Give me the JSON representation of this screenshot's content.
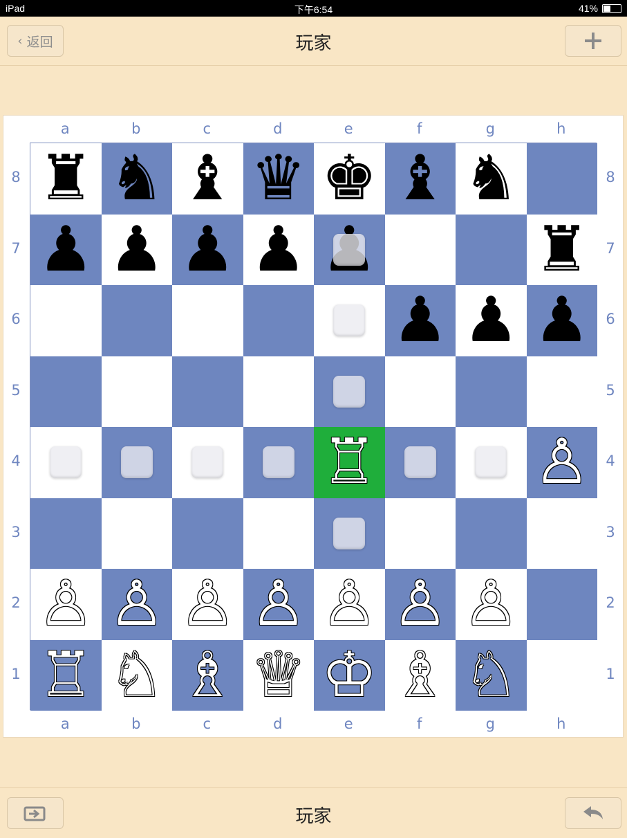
{
  "status_bar": {
    "device": "iPad",
    "time": "下午6:54",
    "battery": "41%",
    "battery_level": 0.41
  },
  "header": {
    "back_label": "返回",
    "title": "玩家",
    "add_icon": "plus-icon"
  },
  "footer": {
    "title": "玩家",
    "left_icon": "export-icon",
    "right_icon": "undo-arrow-icon"
  },
  "board": {
    "files": [
      "a",
      "b",
      "c",
      "d",
      "e",
      "f",
      "g",
      "h"
    ],
    "ranks": [
      "8",
      "7",
      "6",
      "5",
      "4",
      "3",
      "2",
      "1"
    ],
    "colors": {
      "light": "#ffffff",
      "dark": "#6e86bf",
      "selected": "#1fae3b",
      "coords": "#6f86c0"
    },
    "selected_square": "e4",
    "pieces": [
      {
        "square": "a8",
        "piece": "rook",
        "color": "black"
      },
      {
        "square": "b8",
        "piece": "knight",
        "color": "black"
      },
      {
        "square": "c8",
        "piece": "bishop",
        "color": "black"
      },
      {
        "square": "d8",
        "piece": "queen",
        "color": "black"
      },
      {
        "square": "e8",
        "piece": "king",
        "color": "black"
      },
      {
        "square": "f8",
        "piece": "bishop",
        "color": "black"
      },
      {
        "square": "g8",
        "piece": "knight",
        "color": "black"
      },
      {
        "square": "a7",
        "piece": "pawn",
        "color": "black"
      },
      {
        "square": "b7",
        "piece": "pawn",
        "color": "black"
      },
      {
        "square": "c7",
        "piece": "pawn",
        "color": "black"
      },
      {
        "square": "d7",
        "piece": "pawn",
        "color": "black"
      },
      {
        "square": "e7",
        "piece": "pawn",
        "color": "black"
      },
      {
        "square": "h7",
        "piece": "rook",
        "color": "black"
      },
      {
        "square": "f6",
        "piece": "pawn",
        "color": "black"
      },
      {
        "square": "g6",
        "piece": "pawn",
        "color": "black"
      },
      {
        "square": "h6",
        "piece": "pawn",
        "color": "black"
      },
      {
        "square": "e4",
        "piece": "rook",
        "color": "white"
      },
      {
        "square": "h4",
        "piece": "pawn",
        "color": "white"
      },
      {
        "square": "a2",
        "piece": "pawn",
        "color": "white"
      },
      {
        "square": "b2",
        "piece": "pawn",
        "color": "white"
      },
      {
        "square": "c2",
        "piece": "pawn",
        "color": "white"
      },
      {
        "square": "d2",
        "piece": "pawn",
        "color": "white"
      },
      {
        "square": "e2",
        "piece": "pawn",
        "color": "white"
      },
      {
        "square": "f2",
        "piece": "pawn",
        "color": "white"
      },
      {
        "square": "g2",
        "piece": "pawn",
        "color": "white"
      },
      {
        "square": "a1",
        "piece": "rook",
        "color": "white"
      },
      {
        "square": "b1",
        "piece": "knight",
        "color": "white"
      },
      {
        "square": "c1",
        "piece": "bishop",
        "color": "white"
      },
      {
        "square": "d1",
        "piece": "queen",
        "color": "white"
      },
      {
        "square": "e1",
        "piece": "king",
        "color": "white"
      },
      {
        "square": "f1",
        "piece": "bishop",
        "color": "white"
      },
      {
        "square": "g1",
        "piece": "knight",
        "color": "white"
      }
    ],
    "move_targets": [
      "e7",
      "e6",
      "e5",
      "a4",
      "b4",
      "c4",
      "d4",
      "f4",
      "g4",
      "e3"
    ]
  }
}
